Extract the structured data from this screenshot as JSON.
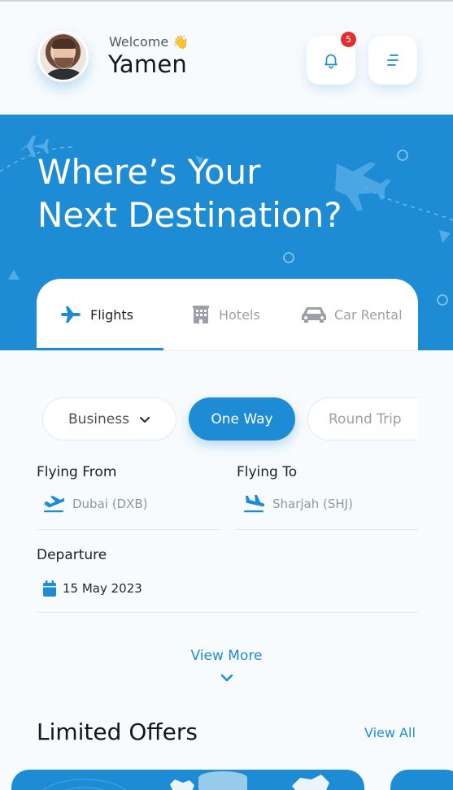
{
  "header": {
    "welcome": "Welcome",
    "wave_emoji": "👋",
    "username": "Yamen",
    "notifications_count": "5"
  },
  "hero": {
    "title_line1": "Where’s Your",
    "title_line2": "Next Destination?"
  },
  "tabs": {
    "flights": "Flights",
    "hotels": "Hotels",
    "car_rental": "Car Rental"
  },
  "options": {
    "class_value": "Business",
    "one_way": "One Way",
    "round_trip": "Round Trip"
  },
  "form": {
    "flying_from_label": "Flying From",
    "flying_from_value": "Dubai (DXB)",
    "flying_to_label": "Flying To",
    "flying_to_value": "Sharjah (SHJ)",
    "departure_label": "Departure",
    "departure_value": "15 May 2023"
  },
  "view_more": "View More",
  "offers": {
    "title": "Limited Offers",
    "view_all": "View All"
  },
  "colors": {
    "accent": "#1e8cd4",
    "badge": "#e02f2f"
  },
  "icons": [
    "bell-icon",
    "menu-icon",
    "plane-icon",
    "hotel-icon",
    "car-icon",
    "chevron-down-icon",
    "takeoff-icon",
    "landing-icon",
    "calendar-icon"
  ]
}
